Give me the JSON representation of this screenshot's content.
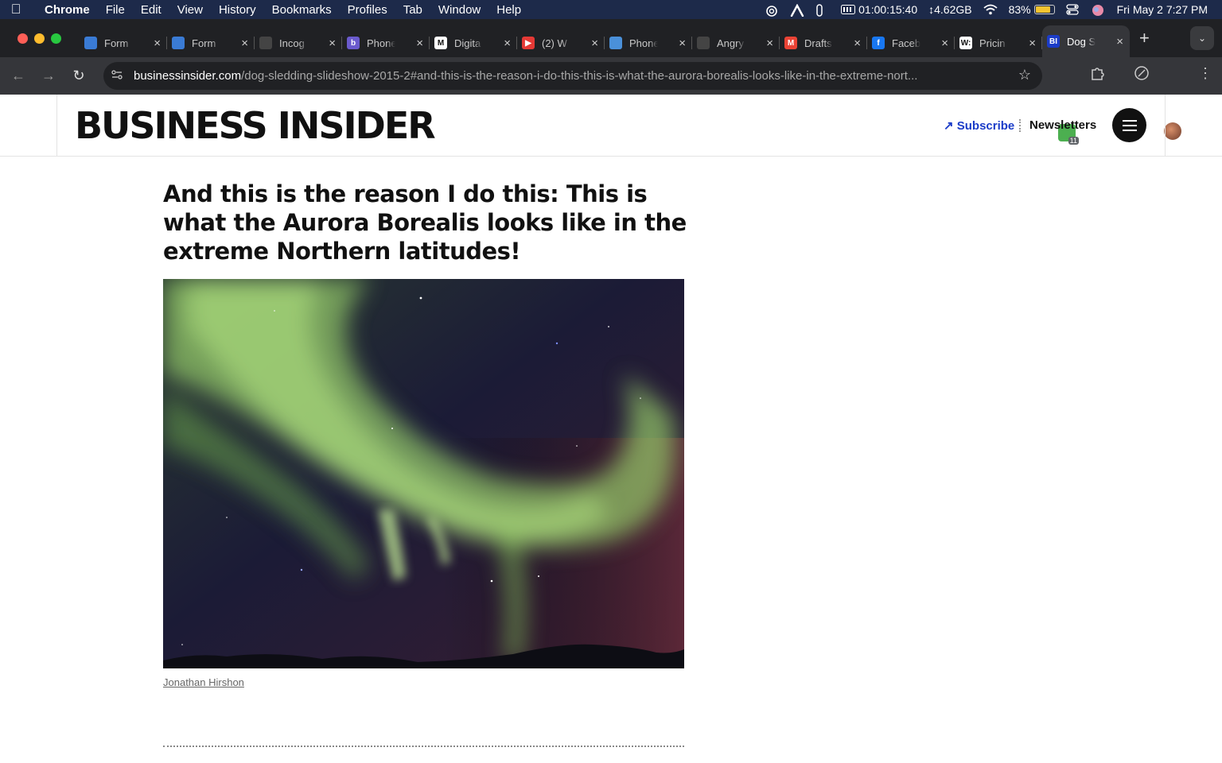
{
  "menubar": {
    "apple": "",
    "app_name": "Chrome",
    "items": [
      "File",
      "Edit",
      "View",
      "History",
      "Bookmarks",
      "Profiles",
      "Tab",
      "Window",
      "Help"
    ],
    "timer": "01:00:15:40",
    "memory": "↕4.62GB",
    "battery_percent": "83%",
    "battery_level": 0.83,
    "datetime": "Fri May 2  7:27 PM"
  },
  "tabs": [
    {
      "title": "Form",
      "favicon_color": "#3a7bd5",
      "icon": "mountain-icon"
    },
    {
      "title": "Form",
      "favicon_color": "#3a7bd5",
      "icon": "mountain-icon"
    },
    {
      "title": "Incog",
      "favicon_color": "#444444",
      "icon": "openai-icon"
    },
    {
      "title": "Phone",
      "favicon_color": "#6a5acd",
      "icon": "b-icon"
    },
    {
      "title": "Digita",
      "favicon_color": "#ffffff",
      "icon": "m-icon"
    },
    {
      "title": "(2) W",
      "favicon_color": "#e53935",
      "icon": "youtube-icon"
    },
    {
      "title": "Phone",
      "favicon_color": "#4a90d9",
      "icon": "phone-icon"
    },
    {
      "title": "Angry",
      "favicon_color": "#444444",
      "icon": "openai-icon"
    },
    {
      "title": "Drafts",
      "favicon_color": "#ea4335",
      "icon": "gmail-icon"
    },
    {
      "title": "Faceb",
      "favicon_color": "#1877f2",
      "icon": "facebook-icon"
    },
    {
      "title": "Pricin",
      "favicon_color": "#ffffff",
      "icon": "w-icon"
    },
    {
      "title": "Dog S",
      "favicon_color": "#1b3cc8",
      "icon": "bi-icon",
      "active": true
    }
  ],
  "tab_favicon_letters": [
    "",
    "",
    "",
    "b",
    "M",
    "▶",
    "",
    "",
    "M",
    "f",
    "W:",
    "BI"
  ],
  "toolbar": {
    "url_host": "businessinsider.com",
    "url_path": "/dog-sledding-slideshow-2015-2#and-this-is-the-reason-i-do-this-this-is-what-the-aurora-borealis-looks-like-in-the-extreme-nort...",
    "extension_badge_count": "11"
  },
  "site": {
    "logo": "BUSINESS INSIDER",
    "subscribe": "Subscribe",
    "newsletters": "Newsletters"
  },
  "article": {
    "headline": "And this is the reason I do this: This is what the Aurora Borealis looks like in the extreme Northern latitudes!",
    "photo_credit": "Jonathan Hirshon"
  }
}
